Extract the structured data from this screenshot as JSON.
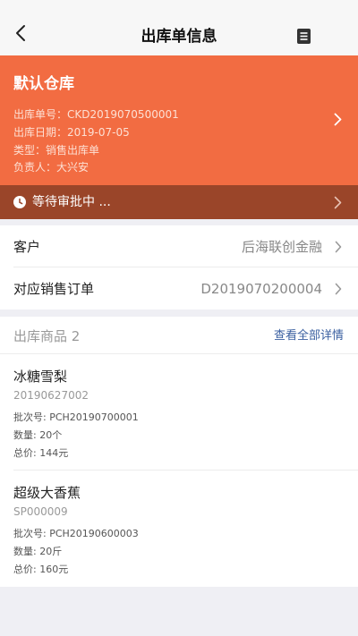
{
  "nav": {
    "title": "出库单信息"
  },
  "header": {
    "warehouse": "默认仓库",
    "order_no": "出库单号：CKD2019070500001",
    "date": "出库日期：2019-07-05",
    "type": "类型：销售出库单",
    "owner": "负责人：大兴安"
  },
  "status": {
    "text": "等待审批中 ..."
  },
  "info": {
    "customer_label": "客户",
    "customer_value": "后海联创金融",
    "order_label": "对应销售订单",
    "order_value": "D2019070200004"
  },
  "goods": {
    "title": "出库商品 2",
    "view_all": "查看全部详情",
    "items": [
      {
        "name": "冰糖雪梨",
        "code": "20190627002",
        "batch": "批次号: PCH20190700001",
        "qty": "数量: 20个",
        "total": "总价: 144元"
      },
      {
        "name": "超级大香蕉",
        "code": "SP000009",
        "batch": "批次号: PCH20190600003",
        "qty": "数量: 20斤",
        "total": "总价: 160元"
      }
    ]
  },
  "colors": {
    "header_bg": "#f26c42",
    "status_bg": "#9a4529",
    "link": "#3a5fa0"
  }
}
